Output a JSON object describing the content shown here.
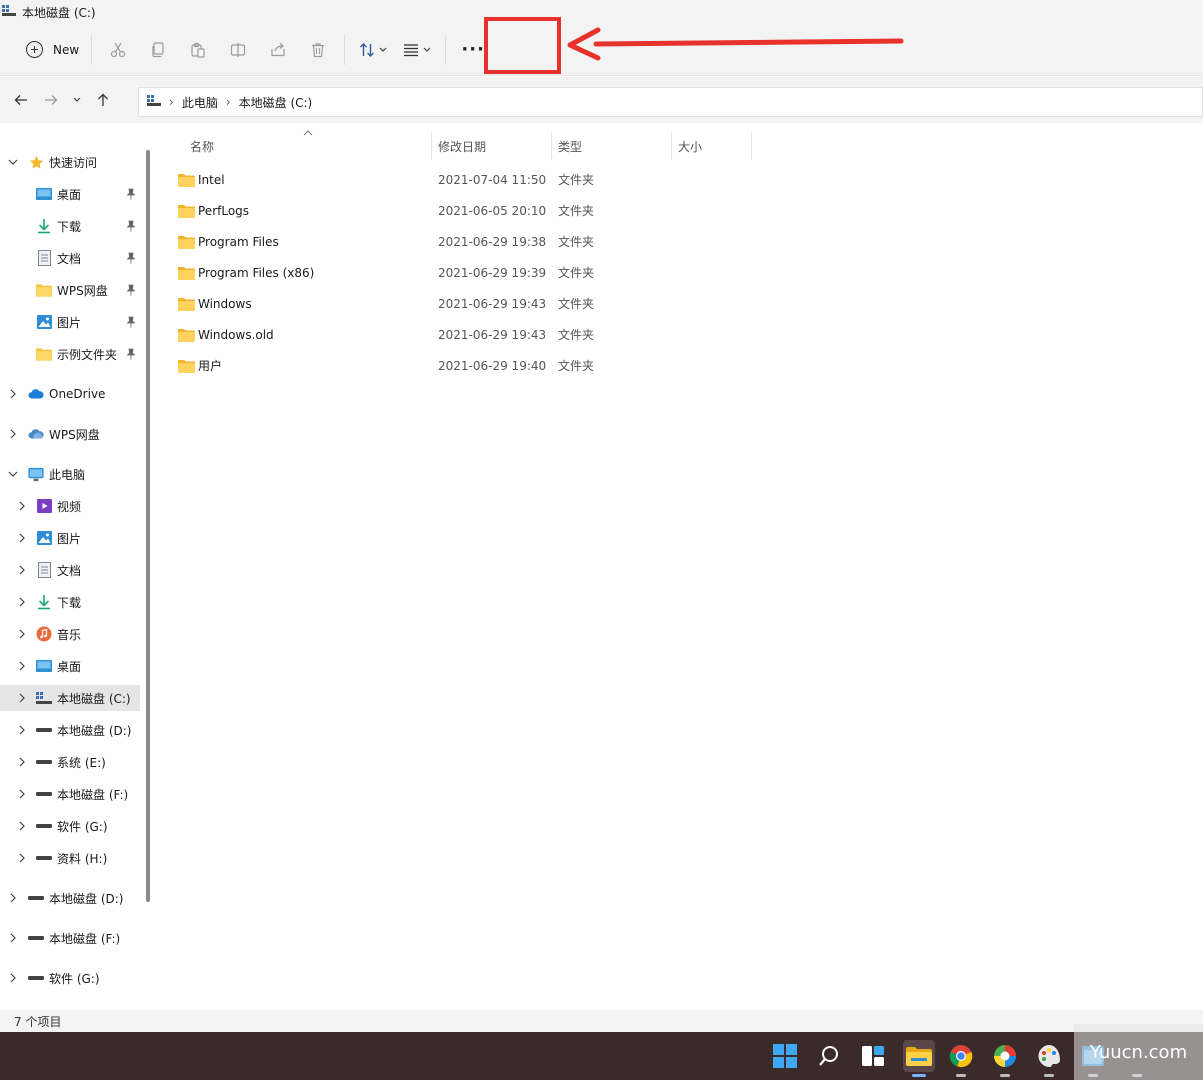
{
  "window": {
    "title": "本地磁盘 (C:)"
  },
  "toolbar": {
    "new_label": "New",
    "more_label": "···",
    "buttons": [
      "cut-icon",
      "copy-icon",
      "paste-icon",
      "rename-icon",
      "share-icon",
      "delete-icon",
      "sort-icon",
      "view-icon"
    ]
  },
  "address": {
    "crumbs": [
      "此电脑",
      "本地磁盘 (C:)"
    ]
  },
  "sidebar": {
    "quick_access": "快速访问",
    "quick_items": [
      "桌面",
      "下载",
      "文档",
      "WPS网盘",
      "图片",
      "示例文件夹"
    ],
    "onedrive": "OneDrive",
    "wps_cloud": "WPS网盘",
    "this_pc": "此电脑",
    "pc_items": [
      "视频",
      "图片",
      "文档",
      "下载",
      "音乐",
      "桌面",
      "本地磁盘 (C:)",
      "本地磁盘 (D:)",
      "系统 (E:)",
      "本地磁盘 (F:)",
      "软件 (G:)",
      "资料 (H:)"
    ],
    "extra_drives": [
      "本地磁盘 (D:)",
      "本地磁盘 (F:)",
      "软件 (G:)"
    ]
  },
  "columns": {
    "name": "名称",
    "modified": "修改日期",
    "type": "类型",
    "size": "大小"
  },
  "files": [
    {
      "name": "Intel",
      "modified": "2021-07-04 11:50",
      "type": "文件夹"
    },
    {
      "name": "PerfLogs",
      "modified": "2021-06-05 20:10",
      "type": "文件夹"
    },
    {
      "name": "Program Files",
      "modified": "2021-06-29 19:38",
      "type": "文件夹"
    },
    {
      "name": "Program Files (x86)",
      "modified": "2021-06-29 19:39",
      "type": "文件夹"
    },
    {
      "name": "Windows",
      "modified": "2021-06-29 19:43",
      "type": "文件夹"
    },
    {
      "name": "Windows.old",
      "modified": "2021-06-29 19:43",
      "type": "文件夹"
    },
    {
      "name": "用户",
      "modified": "2021-06-29 19:40",
      "type": "文件夹"
    }
  ],
  "status": {
    "count": "7 个项目"
  },
  "watermark": "Yuucn.com",
  "colors": {
    "highlight": "#e8312b",
    "folder": "#f5c342",
    "taskbar": "#3a2a2a"
  }
}
